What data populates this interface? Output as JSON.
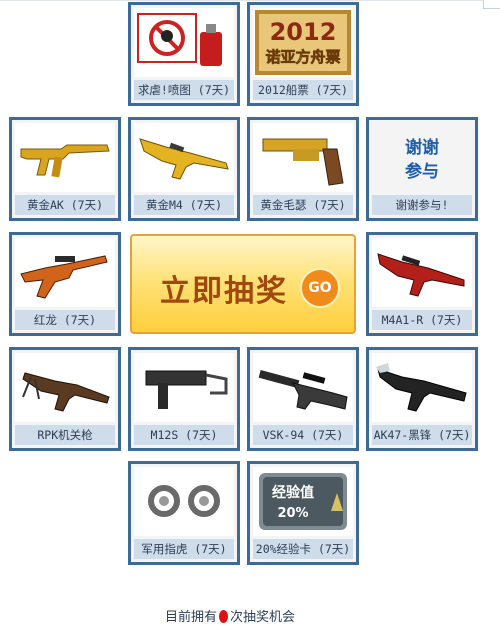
{
  "prizes": [
    {
      "label": "求虐!喷图 (7天)"
    },
    {
      "label": "2012船票 (7天)"
    },
    {
      "label": "黄金AK (7天)"
    },
    {
      "label": "黄金M4 (7天)"
    },
    {
      "label": "黄金毛瑟 (7天)"
    },
    {
      "label": "谢谢参与!"
    },
    {
      "label": "红龙 (7天)"
    },
    {
      "label": "M4A1-R (7天)"
    },
    {
      "label": "RPK机关枪"
    },
    {
      "label": "M12S (7天)"
    },
    {
      "label": "VSK-94 (7天)"
    },
    {
      "label": "AK47-黑锋 (7天)"
    },
    {
      "label": "军用指虎 (7天)"
    },
    {
      "label": "20%经验卡 (7天)"
    }
  ],
  "images": {
    "ticket_year": "2012",
    "ticket_text": "诺亚方舟票",
    "thanks_line1": "谢谢",
    "thanks_line2": "参与",
    "exp_title": "经验值",
    "exp_value": "20%"
  },
  "draw_button": {
    "label": "立即抽奖",
    "go": "GO"
  },
  "footer": {
    "prefix": "目前拥有",
    "suffix": "次抽奖机会"
  }
}
